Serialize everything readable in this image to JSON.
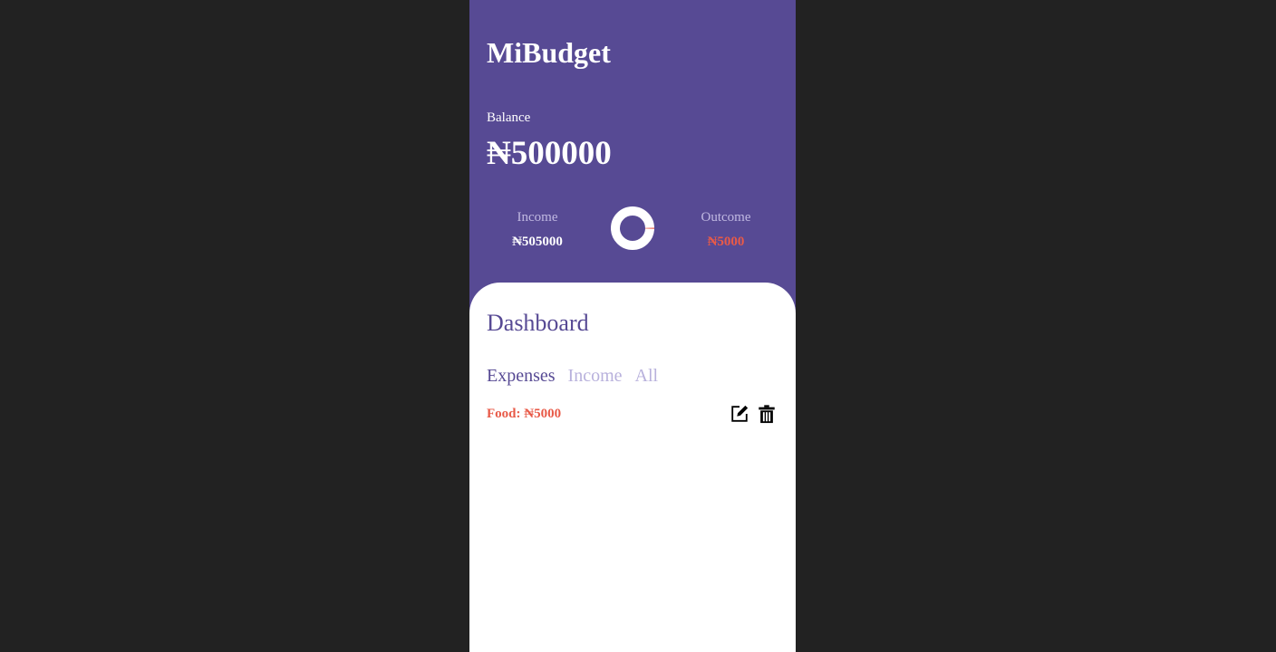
{
  "app": {
    "title": "MiBudget"
  },
  "balance": {
    "label": "Balance",
    "value": "₦500000"
  },
  "summary": {
    "income_label": "Income",
    "income_value": "₦505000",
    "outcome_label": "Outcome",
    "outcome_value": "₦5000",
    "outcome_fraction": 0.0099
  },
  "dashboard": {
    "title": "Dashboard",
    "tabs": [
      {
        "label": "Expenses",
        "active": true
      },
      {
        "label": "Income",
        "active": false
      },
      {
        "label": "All",
        "active": false
      }
    ],
    "entries": [
      {
        "text": "Food: ₦5000",
        "edit_icon": "edit-icon",
        "delete_icon": "trash-icon"
      }
    ]
  },
  "colors": {
    "primary": "#574a94",
    "accent_red": "#e85a48",
    "muted_lavender": "#b8b1dc",
    "page_background": "#222222"
  }
}
